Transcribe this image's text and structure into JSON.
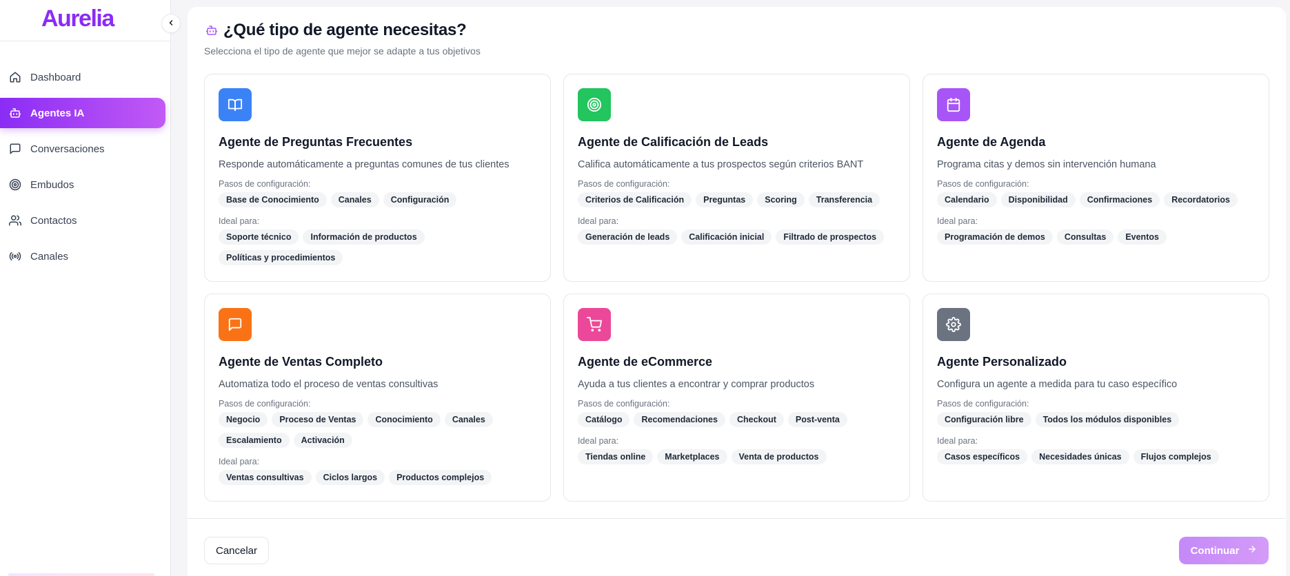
{
  "brand": {
    "name": "Aurelia",
    "color": "#8b2cf5"
  },
  "sidebar": {
    "items": [
      {
        "label": "Dashboard",
        "icon": "home-icon",
        "active": false
      },
      {
        "label": "Agentes IA",
        "icon": "bot-icon",
        "active": true
      },
      {
        "label": "Conversaciones",
        "icon": "message-square-icon",
        "active": false
      },
      {
        "label": "Embudos",
        "icon": "target-icon",
        "active": false
      },
      {
        "label": "Contactos",
        "icon": "users-icon",
        "active": false
      },
      {
        "label": "Canales",
        "icon": "radio-icon",
        "active": false
      }
    ]
  },
  "header": {
    "icon": "bot-icon",
    "title": "¿Qué tipo de agente necesitas?",
    "subtitle": "Selecciona el tipo de agente que mejor se adapte a tus objetivos"
  },
  "labels": {
    "steps": "Pasos de configuración:",
    "ideal": "Ideal para:"
  },
  "cards": [
    {
      "title": "Agente de Preguntas Frecuentes",
      "description": "Responde automáticamente a preguntas comunes de tus clientes",
      "icon": "book-open-icon",
      "color": "#3b82f6",
      "steps": [
        "Base de Conocimiento",
        "Canales",
        "Configuración"
      ],
      "ideal": [
        "Soporte técnico",
        "Información de productos",
        "Políticas y procedimientos"
      ]
    },
    {
      "title": "Agente de Calificación de Leads",
      "description": "Califica automáticamente a tus prospectos según criterios BANT",
      "icon": "target-icon",
      "color": "#22c55e",
      "steps": [
        "Criterios de Calificación",
        "Preguntas",
        "Scoring",
        "Transferencia"
      ],
      "ideal": [
        "Generación de leads",
        "Calificación inicial",
        "Filtrado de prospectos"
      ]
    },
    {
      "title": "Agente de Agenda",
      "description": "Programa citas y demos sin intervención humana",
      "icon": "calendar-icon",
      "color": "#a855f7",
      "steps": [
        "Calendario",
        "Disponibilidad",
        "Confirmaciones",
        "Recordatorios"
      ],
      "ideal": [
        "Programación de demos",
        "Consultas",
        "Eventos"
      ]
    },
    {
      "title": "Agente de Ventas Completo",
      "description": "Automatiza todo el proceso de ventas consultivas",
      "icon": "message-square-icon",
      "color": "#f97316",
      "steps": [
        "Negocio",
        "Proceso de Ventas",
        "Conocimiento",
        "Canales",
        "Escalamiento",
        "Activación"
      ],
      "ideal": [
        "Ventas consultivas",
        "Ciclos largos",
        "Productos complejos"
      ]
    },
    {
      "title": "Agente de eCommerce",
      "description": "Ayuda a tus clientes a encontrar y comprar productos",
      "icon": "shopping-cart-icon",
      "color": "#ec4899",
      "steps": [
        "Catálogo",
        "Recomendaciones",
        "Checkout",
        "Post-venta"
      ],
      "ideal": [
        "Tiendas online",
        "Marketplaces",
        "Venta de productos"
      ]
    },
    {
      "title": "Agente Personalizado",
      "description": "Configura un agente a medida para tu caso específico",
      "icon": "settings-icon",
      "color": "#6b7280",
      "steps": [
        "Configuración libre",
        "Todos los módulos disponibles"
      ],
      "ideal": [
        "Casos específicos",
        "Necesidades únicas",
        "Flujos complejos"
      ]
    }
  ],
  "footer": {
    "cancel_label": "Cancelar",
    "continue_label": "Continuar"
  }
}
